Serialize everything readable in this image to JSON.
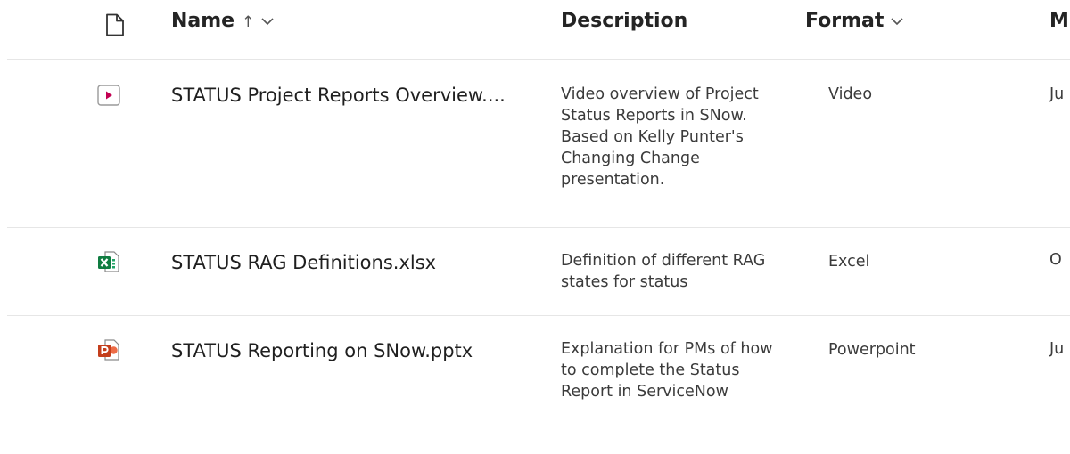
{
  "columns": {
    "name": "Name",
    "description": "Description",
    "format": "Format",
    "modified": "M"
  },
  "icons": {
    "header": "document-icon",
    "sort": "arrow-up-icon",
    "dropdown": "chevron-down-icon",
    "video": "video-icon",
    "excel": "excel-icon",
    "powerpoint": "powerpoint-icon"
  },
  "rows": [
    {
      "name": "STATUS Project Reports Overview....",
      "description": "Video overview of Project Status Reports in SNow. Based on Kelly Punter's Changing Change presentation.",
      "format": "Video",
      "modified": "Ju"
    },
    {
      "name": "STATUS RAG Definitions.xlsx",
      "description": "Definition of different RAG states for status",
      "format": "Excel",
      "modified": "O"
    },
    {
      "name": "STATUS Reporting on SNow.pptx",
      "description": "Explanation for PMs of how to complete the Status Report in ServiceNow",
      "format": "Powerpoint",
      "modified": "Ju"
    }
  ],
  "colors": {
    "text": "#242424",
    "separator": "#e6e6e6",
    "video_accent": "#c30052",
    "excel_green": "#107c41",
    "powerpoint_red": "#c43e1c"
  }
}
